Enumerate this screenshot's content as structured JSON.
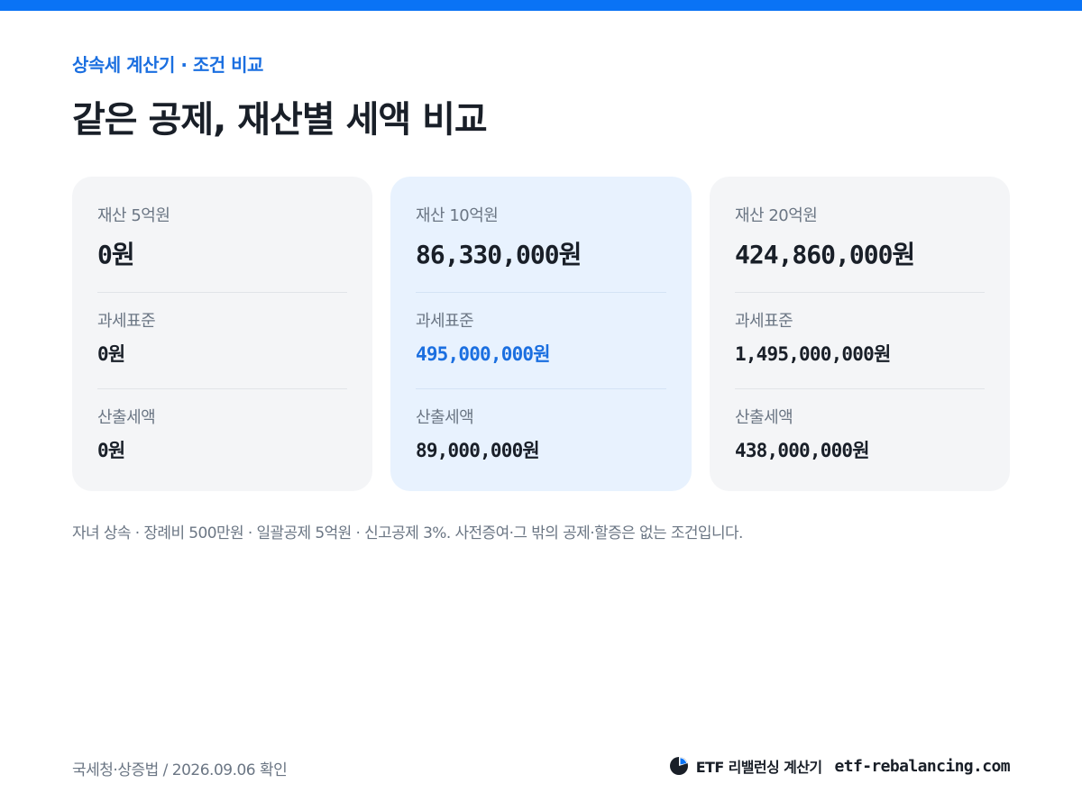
{
  "header": {
    "eyebrow": "상속세 계산기 · 조건 비교",
    "title": "같은 공제, 재산별 세액 비교"
  },
  "cards": [
    {
      "label": "재산 5억원",
      "amount": "0원",
      "tax_base_label": "과세표준",
      "tax_base_value": "0원",
      "calc_tax_label": "산출세액",
      "calc_tax_value": "0원"
    },
    {
      "label": "재산 10억원",
      "amount": "86,330,000원",
      "tax_base_label": "과세표준",
      "tax_base_value": "495,000,000원",
      "calc_tax_label": "산출세액",
      "calc_tax_value": "89,000,000원"
    },
    {
      "label": "재산 20억원",
      "amount": "424,860,000원",
      "tax_base_label": "과세표준",
      "tax_base_value": "1,495,000,000원",
      "calc_tax_label": "산출세액",
      "calc_tax_value": "438,000,000원"
    }
  ],
  "note": "자녀 상속 · 장례비 500만원 · 일괄공제 5억원 · 신고공제 3%. 사전증여·그 밖의 공제·할증은 없는 조건입니다.",
  "footer": {
    "source": "국세청·상증법 / 2026.09.06 확인",
    "brand_name": "ETF 리밸런싱 계산기",
    "brand_url": "etf-rebalancing.com",
    "brand_icon": "pie-chart-icon"
  },
  "colors": {
    "accent": "#0a73f5",
    "accent_text": "#1b6fe0",
    "card_bg": "#f4f5f7",
    "card_highlight_bg": "#e8f2fe"
  }
}
